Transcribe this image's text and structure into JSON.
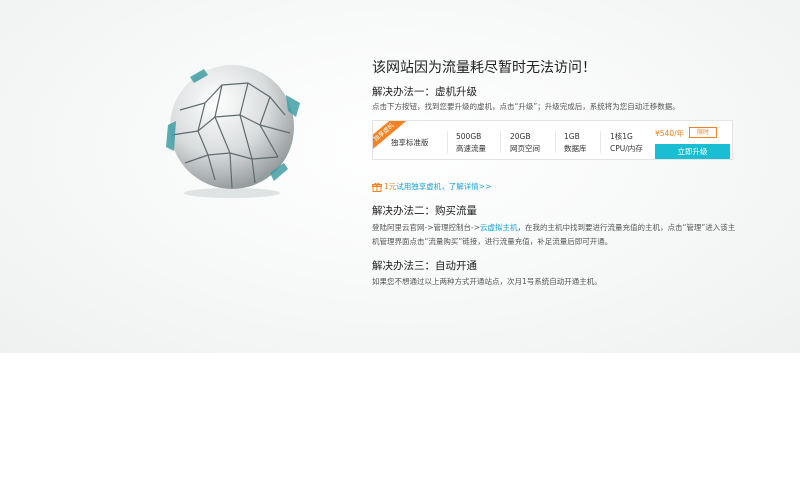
{
  "page": {
    "title": "该网站因为流量耗尽暂时无法访问！"
  },
  "solution1": {
    "title": "解决办法一：虚机升级",
    "desc": "点击下方按钮，找到您要升级的虚机，点击“升级”；升级完成后，系统将为您自动迁移数据。"
  },
  "plan": {
    "ribbon": "独享虚机",
    "name": "独享标准版",
    "specs": [
      {
        "value": "500GB",
        "label": "高速流量"
      },
      {
        "value": "20GB",
        "label": "网页空间"
      },
      {
        "value": "1GB",
        "label": "数据库"
      },
      {
        "value": "1核1G",
        "label": "CPU/内存"
      }
    ],
    "price": "¥540/年",
    "limit_tag": "限时",
    "upgrade_label": "立即升级"
  },
  "promo": {
    "part1": "1元",
    "part2": "试用独享虚机，了解详情>>"
  },
  "solution2": {
    "title": "解决办法二：购买流量",
    "desc_prefix": "登陆阿里云官网->管理控制台->",
    "desc_link": "云虚拟主机",
    "desc_suffix": "，在我的主机中找到要进行流量充值的主机，点击“管理”进入该主机管理界面点击“流量购买”链接，进行流量充值，补足流量后即可开通。"
  },
  "solution3": {
    "title": "解决办法三：自动开通",
    "desc": "如果您不想通过以上两种方式开通站点，次月1号系统自动开通主机。"
  },
  "colors": {
    "accent_orange": "#f58220",
    "accent_cyan": "#19bed3",
    "link_blue": "#19a3d3"
  }
}
